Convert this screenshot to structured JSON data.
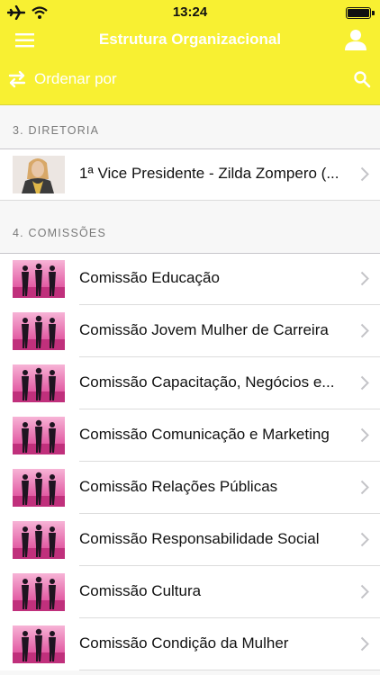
{
  "status_bar": {
    "time": "13:24",
    "icons": [
      "airplane-icon",
      "wifi-icon",
      "battery-icon"
    ]
  },
  "nav": {
    "title": "Estrutura Organizacional",
    "menu_icon": "hamburger-menu-icon",
    "user_icon": "user-icon"
  },
  "toolbar": {
    "sort_label": "Ordenar por",
    "sort_icon": "swap-arrows-icon",
    "search_icon": "search-icon"
  },
  "colors": {
    "accent": "#f8f032",
    "text_on_accent": "#ffffff",
    "section_text": "#7a7a7a",
    "chevron": "#c4c4c8"
  },
  "sections": [
    {
      "header": "3. DIRETORIA",
      "items": [
        {
          "label": "1ª Vice Presidente - Zilda Zompero (...",
          "thumb": "portrait-photo"
        }
      ]
    },
    {
      "header": "4. COMISSÕES",
      "items": [
        {
          "label": "Comissão Educação",
          "thumb": "women-silhouettes"
        },
        {
          "label": "Comissão Jovem Mulher de Carreira",
          "thumb": "women-silhouettes"
        },
        {
          "label": "Comissão Capacitação, Negócios e...",
          "thumb": "women-silhouettes"
        },
        {
          "label": "Comissão Comunicação e Marketing",
          "thumb": "women-silhouettes"
        },
        {
          "label": "Comissão Relações Públicas",
          "thumb": "women-silhouettes"
        },
        {
          "label": "Comissão Responsabilidade Social",
          "thumb": "women-silhouettes"
        },
        {
          "label": "Comissão Cultura",
          "thumb": "women-silhouettes"
        },
        {
          "label": "Comissão Condição da Mulher",
          "thumb": "women-silhouettes"
        }
      ]
    }
  ]
}
